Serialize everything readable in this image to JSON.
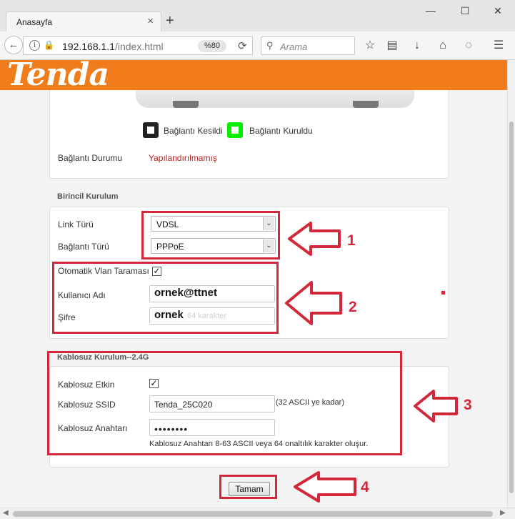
{
  "browser": {
    "tab_title": "Anasayfa",
    "tab_close": "×",
    "new_tab": "+",
    "url_host": "192.168.1.1",
    "url_path": "/index.html",
    "zoom": "%80",
    "search_placeholder": "Arama",
    "window_minimize": "—",
    "window_maximize": "☐",
    "window_close": "✕"
  },
  "brand": {
    "logo": "Tenda"
  },
  "status": {
    "disconnected_label": "Bağlantı Kesildi",
    "connected_label": "Bağlantı Kuruldu",
    "disconnected_color": "#222222",
    "connected_color": "#00ee00",
    "connection_status_label": "Bağlantı Durumu",
    "connection_status_value": "Yapılandırılmamış"
  },
  "primary": {
    "title": "Birincil Kurulum",
    "link_type_label": "Link Türü",
    "link_type_value": "VDSL",
    "connection_type_label": "Bağlantı Türü",
    "connection_type_value": "PPPoE",
    "vlan_label": "Otomatik Vlan Taraması",
    "vlan_checked": true,
    "username_label": "Kullanıcı Adı",
    "username_value": "ornek@ttnet",
    "password_label": "Şifre",
    "password_value": "ornek",
    "password_hint": "64 karakter"
  },
  "wireless": {
    "title": "Kablosuz Kurulum--2.4G",
    "enabled_label": "Kablosuz Etkin",
    "enabled_checked": true,
    "ssid_label": "Kablosuz SSID",
    "ssid_value": "Tenda_25C020",
    "ssid_hint": "(32 ASCII ye kadar)",
    "key_label": "Kablosuz Anahtarı",
    "key_value": "••••••••",
    "key_hint": "Kablosuz Anahtarı 8-63 ASCII veya 64 onaltılık karakter oluşur."
  },
  "actions": {
    "ok_label": "Tamam"
  },
  "annotations": {
    "n1": "1",
    "n2": "2",
    "n3": "3",
    "n4": "4",
    "color": "#d3283a"
  },
  "icons": [
    "back-arrow-icon",
    "info-icon",
    "insecure-lock-icon",
    "reload-icon",
    "search-icon",
    "star-icon",
    "reader-icon",
    "download-icon",
    "home-icon",
    "pocket-icon",
    "menu-icon",
    "checkmark-icon",
    "chevron-down-icon",
    "ethernet-port-icon",
    "arrow-left-icon"
  ]
}
